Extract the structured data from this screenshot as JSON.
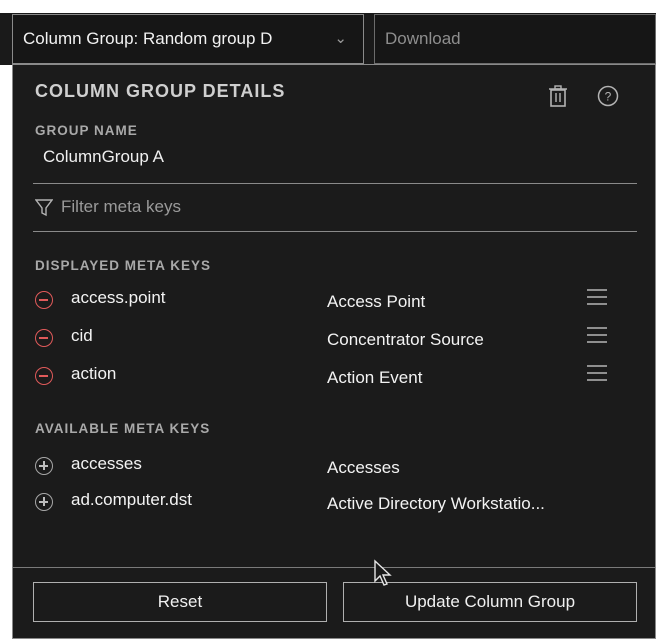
{
  "toolbar": {
    "column_group_select": "Column Group: Random group D",
    "download_label": "Download"
  },
  "panel": {
    "title": "COLUMN GROUP DETAILS",
    "group_name_label": "GROUP NAME",
    "group_name_value": "ColumnGroup A",
    "filter_placeholder": "Filter meta keys",
    "displayed_label": "DISPLAYED META KEYS",
    "displayed": [
      {
        "key": "access.point",
        "description": "Access Point"
      },
      {
        "key": "cid",
        "description": "Concentrator Source"
      },
      {
        "key": "action",
        "description": "Action Event"
      }
    ],
    "available_label": "AVAILABLE META KEYS",
    "available": [
      {
        "key": "accesses",
        "description": "Accesses"
      },
      {
        "key": "ad.computer.dst",
        "description": "Active Directory Workstatio..."
      }
    ]
  },
  "buttons": {
    "reset": "Reset",
    "update": "Update Column Group"
  },
  "colors": {
    "background": "#1b1b1b",
    "remove_icon": "#e05a5a",
    "border": "#8a8a8a"
  },
  "icons": [
    "chevron-down-icon",
    "trash-icon",
    "help-icon",
    "filter-icon",
    "remove-circle-icon",
    "add-circle-icon",
    "drag-handle-icon",
    "mouse-cursor-icon"
  ]
}
